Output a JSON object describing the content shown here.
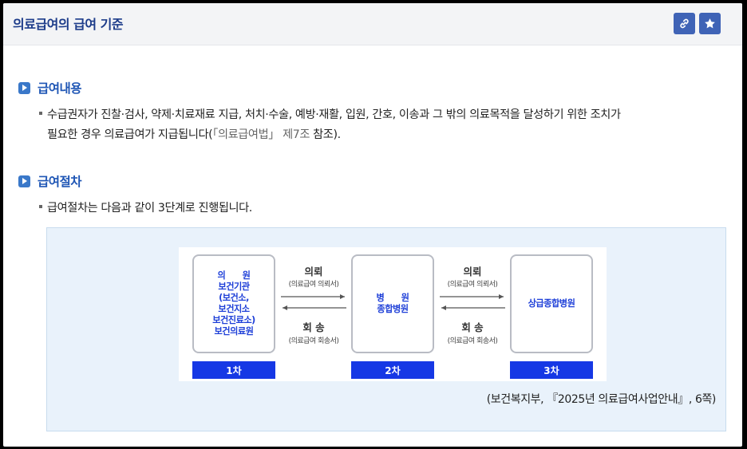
{
  "header": {
    "title": "의료급여의 급여 기준",
    "link_icon": "link-icon",
    "star_icon": "star-icon"
  },
  "sections": [
    {
      "heading": "급여내용",
      "lines": [
        "수급권자가 진찰·검사, 약제·치료재료 지급, 처치·수술, 예방·재활, 입원, 간호, 이송과 그 밖의 의료목적을 달성하기 위한 조치가",
        "필요한 경우 의료급여가 지급됩니다("
      ],
      "law_ref": "「의료급여법」 제7조",
      "tail": " 참조)."
    },
    {
      "heading": "급여절차",
      "lines": [
        "급여절차는 다음과 같이 3단계로 진행됩니다."
      ]
    }
  ],
  "diagram": {
    "nodes": [
      {
        "label": "의　　원\n보건기관\n(보건소,\n보건지소\n보건진료소)\n보건의료원",
        "stage": "1차"
      },
      {
        "label": "병　　원\n종합병원",
        "stage": "2차"
      },
      {
        "label": "상급종합병원",
        "stage": "3차"
      }
    ],
    "connectors": [
      {
        "top": "의뢰",
        "top_sub": "(의료급여 의뢰서)",
        "bottom": "회 송",
        "bottom_sub": "(의료급여 회송서)"
      },
      {
        "top": "의뢰",
        "top_sub": "(의료급여 의뢰서)",
        "bottom": "회 송",
        "bottom_sub": "(의료급여 회송서)"
      }
    ],
    "source": "(보건복지부, 『2025년 의료급여사업안내』, 6쪽)"
  }
}
